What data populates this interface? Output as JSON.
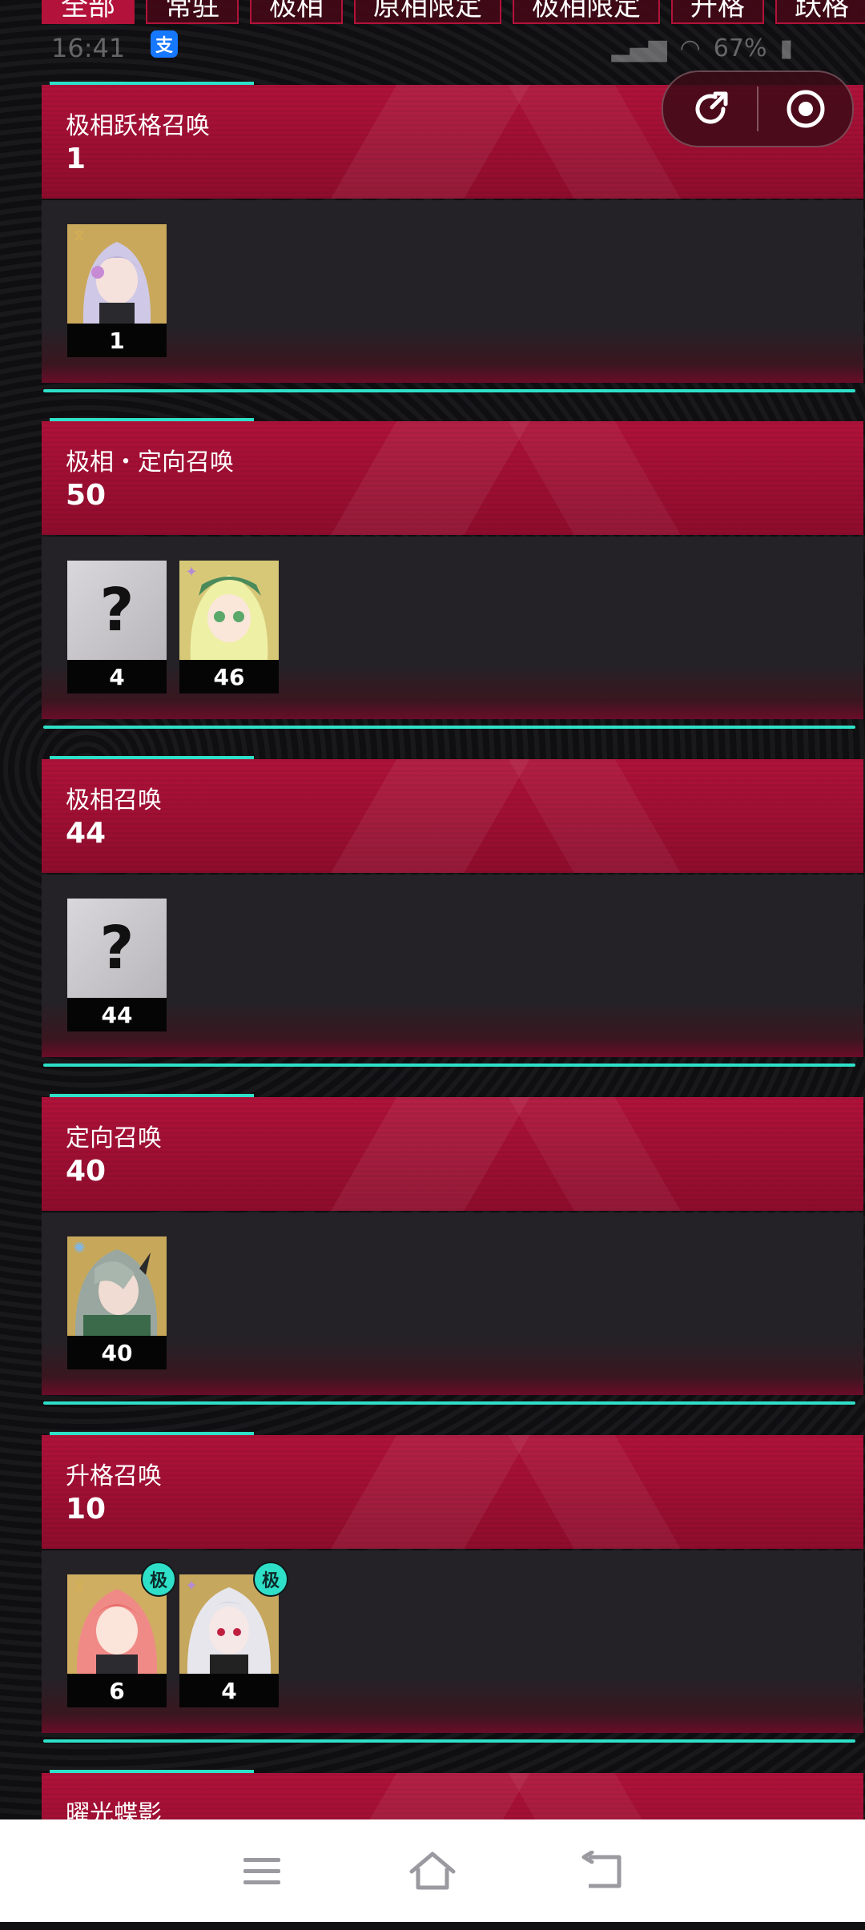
{
  "tabs": [
    {
      "label": "全部",
      "active": true
    },
    {
      "label": "常驻",
      "active": false
    },
    {
      "label": "极相",
      "active": false
    },
    {
      "label": "原相限定",
      "active": false
    },
    {
      "label": "极相限定",
      "active": false
    },
    {
      "label": "升格",
      "active": false
    },
    {
      "label": "跃格",
      "active": false
    }
  ],
  "status_bar": {
    "time": "16:41",
    "alipay_icon_label": "支",
    "battery": "67%"
  },
  "capsule": {
    "share_icon": "share-icon",
    "close_icon": "record-circle-icon"
  },
  "cards": [
    {
      "title": "极相跃格召唤",
      "count": "1",
      "items": [
        {
          "count": "1",
          "portrait": "lilac-hair-character",
          "badge": null
        }
      ]
    },
    {
      "title": "极相・定向召唤",
      "count": "50",
      "items": [
        {
          "count": "4",
          "portrait": "unknown",
          "badge": null
        },
        {
          "count": "46",
          "portrait": "green-hair-character",
          "badge": null
        }
      ]
    },
    {
      "title": "极相召唤",
      "count": "44",
      "items": [
        {
          "count": "44",
          "portrait": "unknown",
          "badge": null
        }
      ]
    },
    {
      "title": "定向召唤",
      "count": "40",
      "items": [
        {
          "count": "40",
          "portrait": "silver-hair-horned-character",
          "badge": null
        }
      ]
    },
    {
      "title": "升格召唤",
      "count": "10",
      "items": [
        {
          "count": "6",
          "portrait": "pink-hair-character",
          "badge": "极"
        },
        {
          "count": "4",
          "portrait": "white-hair-character",
          "badge": "极"
        }
      ]
    },
    {
      "title": "曜光蝶影",
      "count": "",
      "items": []
    }
  ],
  "nav": {
    "menu_icon": "menu-icon",
    "home_icon": "home-icon",
    "back_icon": "back-icon"
  },
  "colors": {
    "accent_teal": "#2fe0c8",
    "header_red": "#b0123a",
    "body_dark": "#242226"
  }
}
